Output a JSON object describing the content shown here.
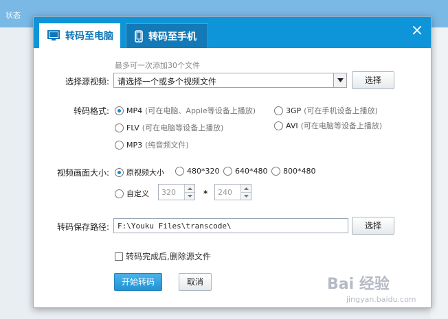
{
  "dialog": {
    "tabs": [
      {
        "label": "转码至电脑",
        "icon": "monitor-icon",
        "active": true
      },
      {
        "label": "转码至手机",
        "icon": "phone-icon",
        "active": false
      }
    ],
    "close_label": "×"
  },
  "source": {
    "hint": "最多可一次添加30个文件",
    "label": "选择源视频:",
    "value": "请选择一个或多个视频文件",
    "choose_label": "选择"
  },
  "format": {
    "label": "转码格式:",
    "options": [
      {
        "name": "MP4",
        "desc": "(可在电脑、Apple等设备上播放)",
        "selected": true
      },
      {
        "name": "3GP",
        "desc": "(可在手机设备上播放)",
        "selected": false
      },
      {
        "name": "FLV",
        "desc": "(可在电脑等设备上播放)",
        "selected": false
      },
      {
        "name": "AVI",
        "desc": "(可在电脑等设备上播放)",
        "selected": false
      },
      {
        "name": "MP3",
        "desc": "(纯音频文件)",
        "selected": false
      }
    ]
  },
  "size": {
    "label": "视频画面大小:",
    "options": [
      {
        "name": "原视频大小",
        "selected": true
      },
      {
        "name": "480*320",
        "selected": false
      },
      {
        "name": "640*480",
        "selected": false
      },
      {
        "name": "800*480",
        "selected": false
      },
      {
        "name": "自定义",
        "selected": false
      }
    ],
    "custom_width": "320",
    "custom_height": "240",
    "separator": "*"
  },
  "save": {
    "label": "转码保存路径:",
    "path": "F:\\Youku Files\\transcode\\",
    "choose_label": "选择"
  },
  "delete_source": {
    "label": "转码完成后,删除源文件",
    "checked": false
  },
  "actions": {
    "start_label": "开始转码",
    "cancel_label": "取消"
  },
  "watermark": {
    "logo": "Bai 经验",
    "sub": "jingyan.baidu.com"
  },
  "background": {
    "status_label": "状态"
  },
  "colors": {
    "accent": "#0e94d8",
    "primary_button": "#2393d3"
  }
}
